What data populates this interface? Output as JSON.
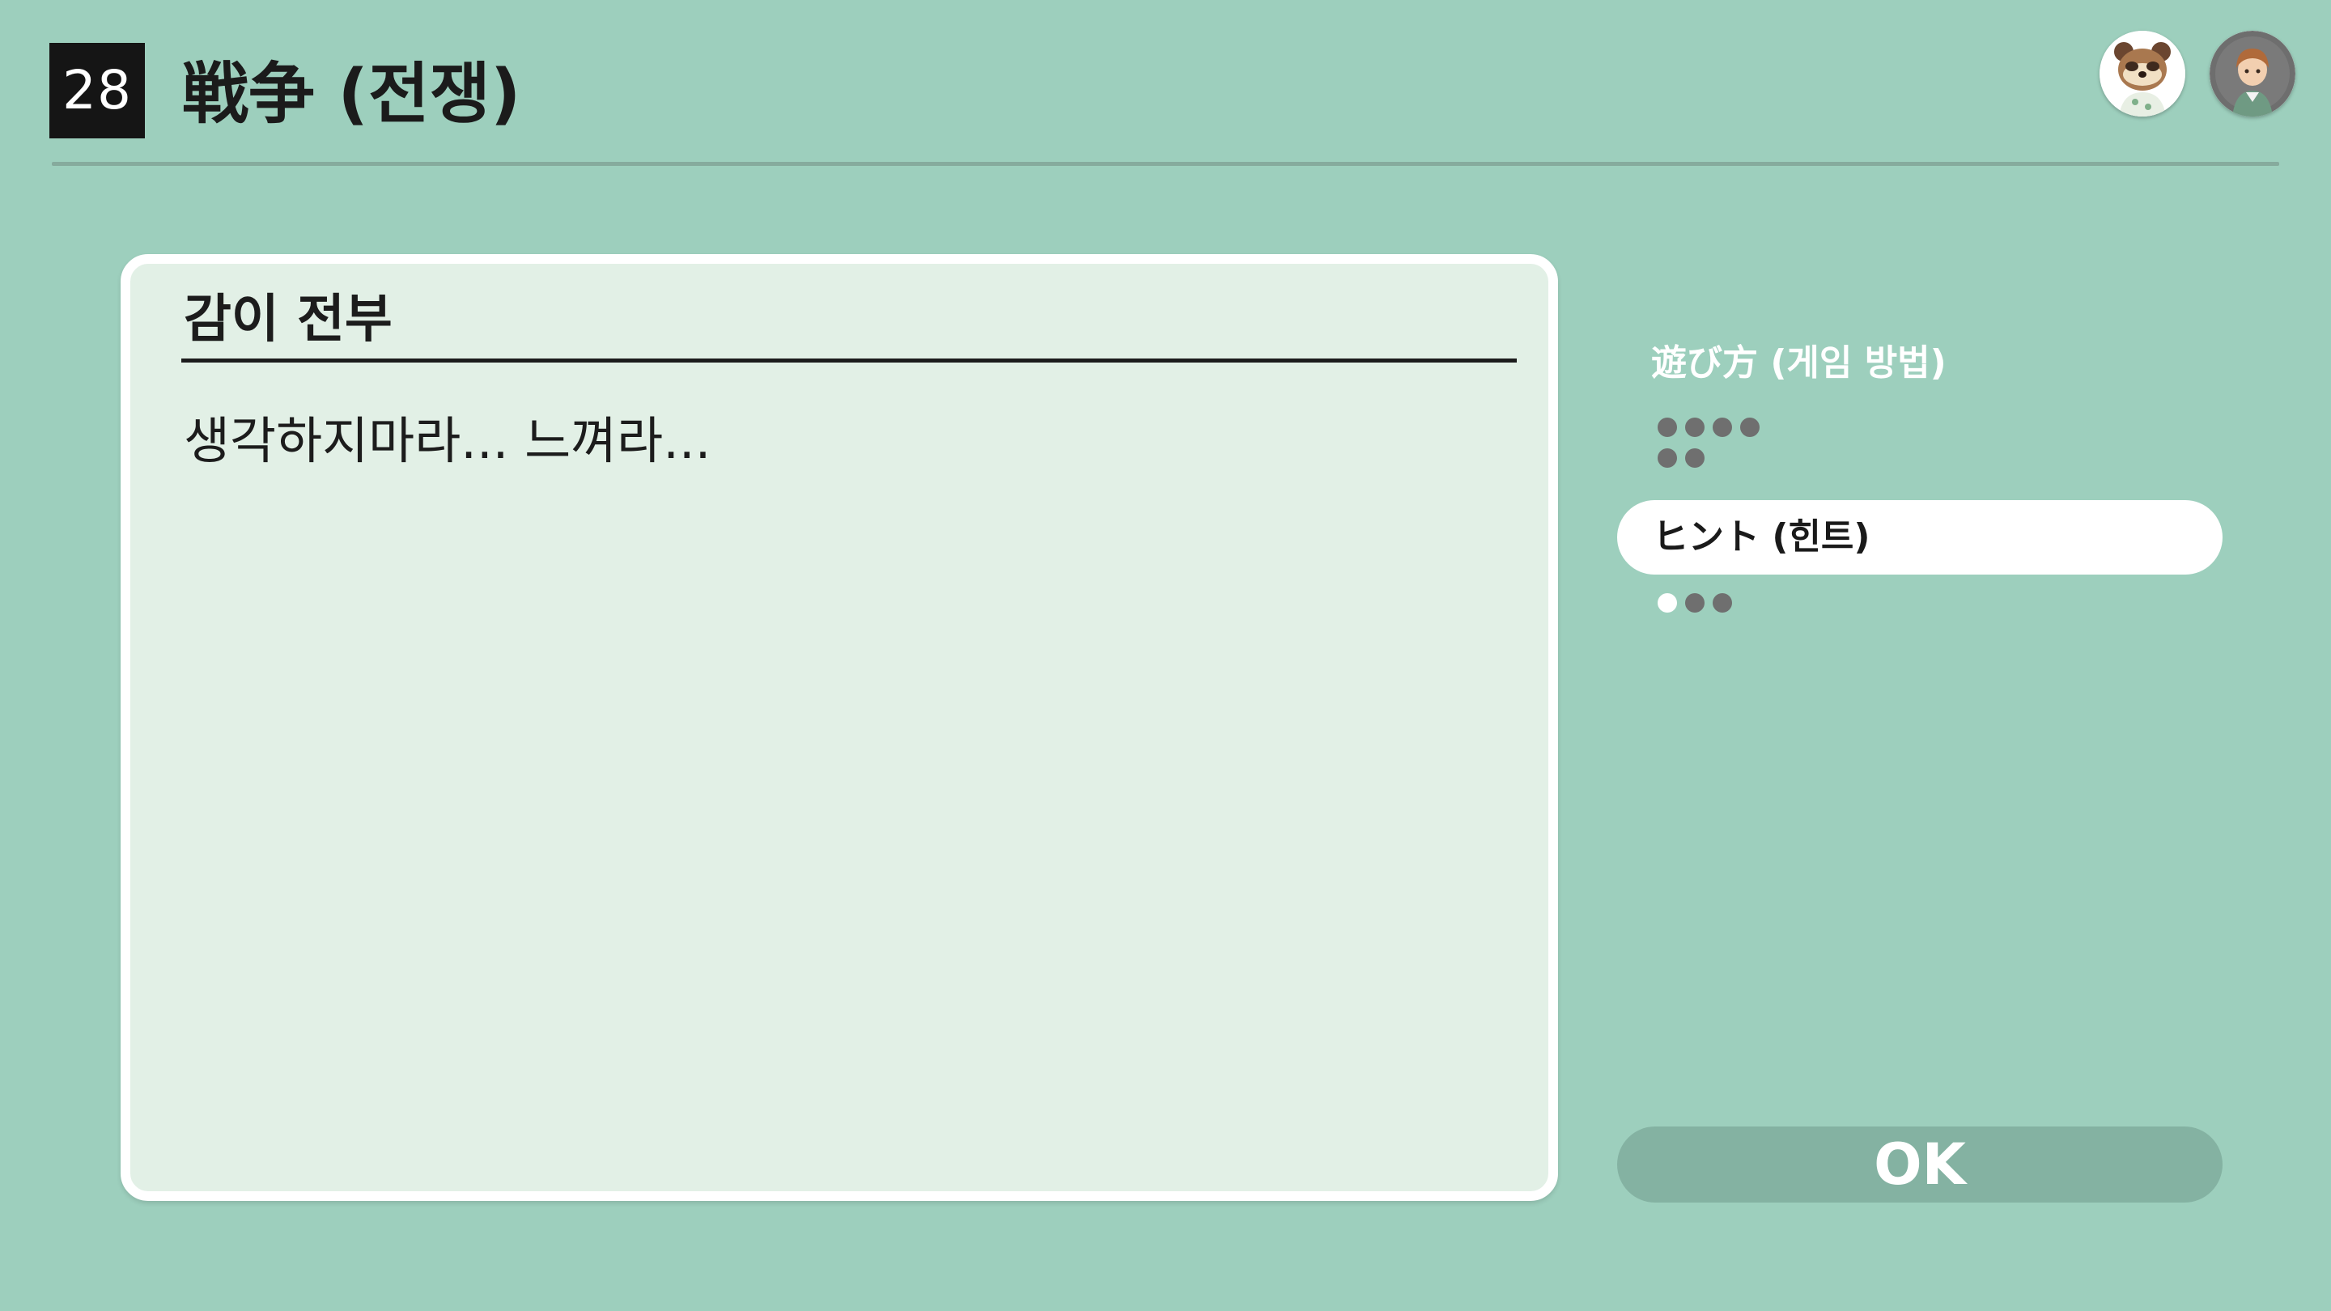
{
  "header": {
    "number": "28",
    "title": "戦争 (전쟁)"
  },
  "card": {
    "heading": "감이 전부",
    "body": "생각하지마라... 느껴라..."
  },
  "side": {
    "how_to_play_label": "遊び方 (게임 방법)",
    "hint_label": "ヒント (힌트)",
    "ok_label": "OK"
  },
  "avatars": [
    "raccoon-character-icon",
    "player-character-icon"
  ],
  "colors": {
    "background": "#9dcfbd",
    "card": "#e2f0e6",
    "ok_button": "#84b2a2",
    "dot_inactive": "#6f6f6f",
    "dot_active": "#ffffff"
  }
}
